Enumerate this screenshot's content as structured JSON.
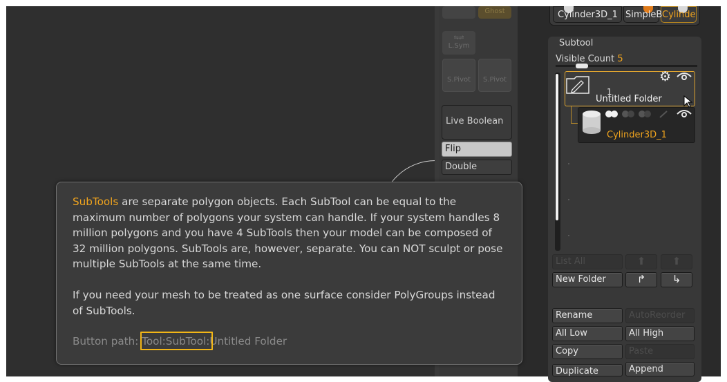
{
  "shelf": {
    "ghost_label": "Ghost",
    "lsym_label": "L.Sym",
    "spivot_label": "S.Pivot",
    "spivot2_label": "S.Pivot",
    "live_boolean": "Live Boolean",
    "flip": "Flip",
    "double": "Double"
  },
  "tool_thumbs": [
    "Cylinder3D_1",
    "SimpleB",
    "Cylinde"
  ],
  "subtool": {
    "title": "Subtool",
    "visible_count_label": "Visible Count",
    "visible_count_value": "5",
    "folder": {
      "count": "1",
      "name": "Untitled Folder"
    },
    "cylinder": {
      "name": "Cylinder3D_1"
    }
  },
  "buttons": {
    "list_all": "List All",
    "new_folder": "New Folder",
    "rename": "Rename",
    "auto_reorder": "AutoReorder",
    "all_low": "All Low",
    "all_high": "All High",
    "copy": "Copy",
    "paste": "Paste",
    "append": "Append",
    "duplicate": "Duplicate"
  },
  "tooltip": {
    "keyword": "SubTools",
    "para1_rest": " are separate polygon objects. Each SubTool can be equal to the maximum number of polygons your system can handle. If your system handles 8 million polygons and you have 4 SubTools then your model can be composed of 32 million polygons. SubTools are, however, separate. You can NOT sculpt or pose multiple SubTools at the same time.",
    "para2": "If you need your mesh to be treated as one surface consider PolyGroups instead of SubTools.",
    "button_path_label": "Button path: ",
    "button_path_value": "Tool:SubTool:Untitled Folder"
  },
  "colors": {
    "accent": "#f0a41e",
    "highlight_box": "#f2b617",
    "panel_bg": "#383838",
    "tooltip_bg": "#3b3b3b"
  },
  "icons": [
    "pencil-folder-icon",
    "gear-icon",
    "eye-icon",
    "cursor-arrow-icon",
    "move-up-icon",
    "move-down-icon",
    "arrow-up-right-icon",
    "arrow-down-right-icon"
  ]
}
